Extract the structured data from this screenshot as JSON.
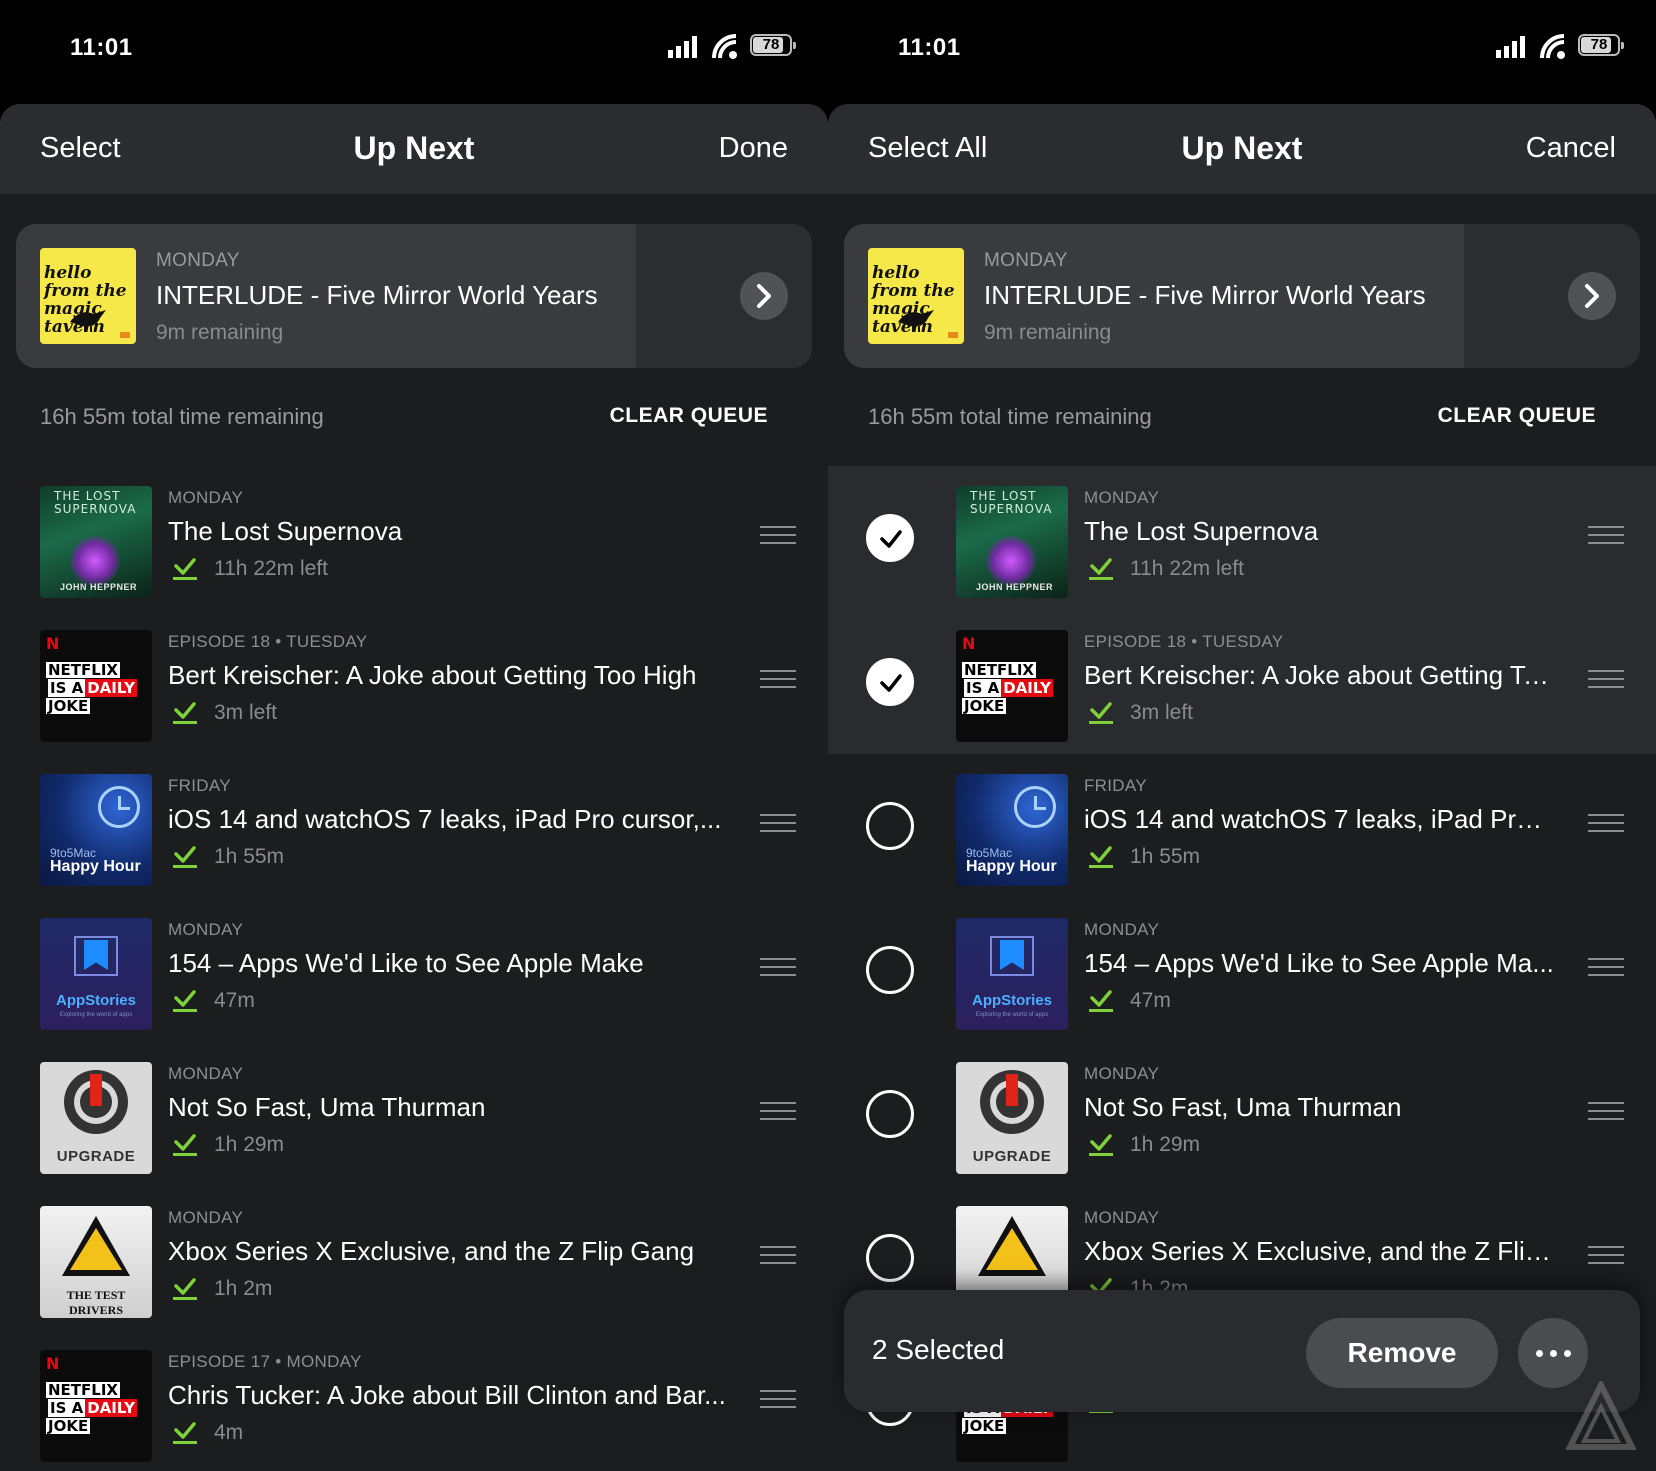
{
  "status": {
    "time": "11:01",
    "battery": "78"
  },
  "left": {
    "nav": {
      "left": "Select",
      "title": "Up Next",
      "right": "Done"
    }
  },
  "right": {
    "nav": {
      "left": "Select All",
      "title": "Up Next",
      "right": "Cancel"
    },
    "selected_count": "2 Selected",
    "remove_label": "Remove"
  },
  "now_playing": {
    "day": "MONDAY",
    "title": "INTERLUDE - Five Mirror World Years",
    "remaining": "9m remaining",
    "artwork_text": "hello from the magic tavern"
  },
  "queue": {
    "total": "16h 55m total time remaining",
    "clear_label": "CLEAR QUEUE"
  },
  "episodes": [
    {
      "day": "MONDAY",
      "title": "The Lost Supernova",
      "title_right": "The Lost Supernova",
      "duration": "11h 22m left",
      "art": "lost",
      "selected": true,
      "art_text": "THE LOST SUPERNOVA",
      "art_author": "JOHN HEPPNER"
    },
    {
      "day": "EPISODE 18 • TUESDAY",
      "title": "Bert Kreischer: A Joke about Getting Too High",
      "title_right": "Bert Kreischer: A Joke about Getting To...",
      "duration": "3m left",
      "art": "netflix",
      "selected": true,
      "art_n": "N",
      "art_w1": "NETFLIX",
      "art_w2a": "IS A",
      "art_w2b": "DAILY",
      "art_w3": "JOKE"
    },
    {
      "day": "FRIDAY",
      "title": "iOS 14 and watchOS 7 leaks, iPad Pro cursor,...",
      "title_right": "iOS 14 and watchOS 7 leaks, iPad Pro c...",
      "duration": "1h 55m",
      "art": "happy",
      "selected": false,
      "art_small": "9to5Mac",
      "art_big": "Happy Hour"
    },
    {
      "day": "MONDAY",
      "title": "154 – Apps We'd Like to See Apple Make",
      "title_right": "154 – Apps We'd Like to See Apple Ma...",
      "duration": "47m",
      "art": "app",
      "selected": false,
      "art_label": "AppStories",
      "art_sub": "Exploring the world of apps"
    },
    {
      "day": "MONDAY",
      "title": "Not So Fast, Uma Thurman",
      "title_right": "Not So Fast, Uma Thurman",
      "duration": "1h 29m",
      "art": "upgrade",
      "selected": false,
      "art_label": "UPGRADE"
    },
    {
      "day": "MONDAY",
      "title": "Xbox Series X Exclusive, and the Z Flip Gang",
      "title_right": "Xbox Series X Exclusive, and the Z Flip...",
      "duration": "1h 2m",
      "art": "test",
      "selected": false,
      "art_label": "THE TEST DRIVERS"
    },
    {
      "day": "EPISODE 17 • MONDAY",
      "title": "Chris Tucker: A Joke about Bill Clinton and Bar...",
      "title_right": "",
      "duration": "4m",
      "art": "netflix",
      "selected": false,
      "art_n": "N",
      "art_w1": "NETFLIX",
      "art_w2a": "IS A",
      "art_w2b": "DAILY",
      "art_w3": "JOKE"
    }
  ],
  "colors": {
    "accent_green": "#7fd13b",
    "background": "#1c1d1f",
    "navbar": "#2b2c2f"
  }
}
